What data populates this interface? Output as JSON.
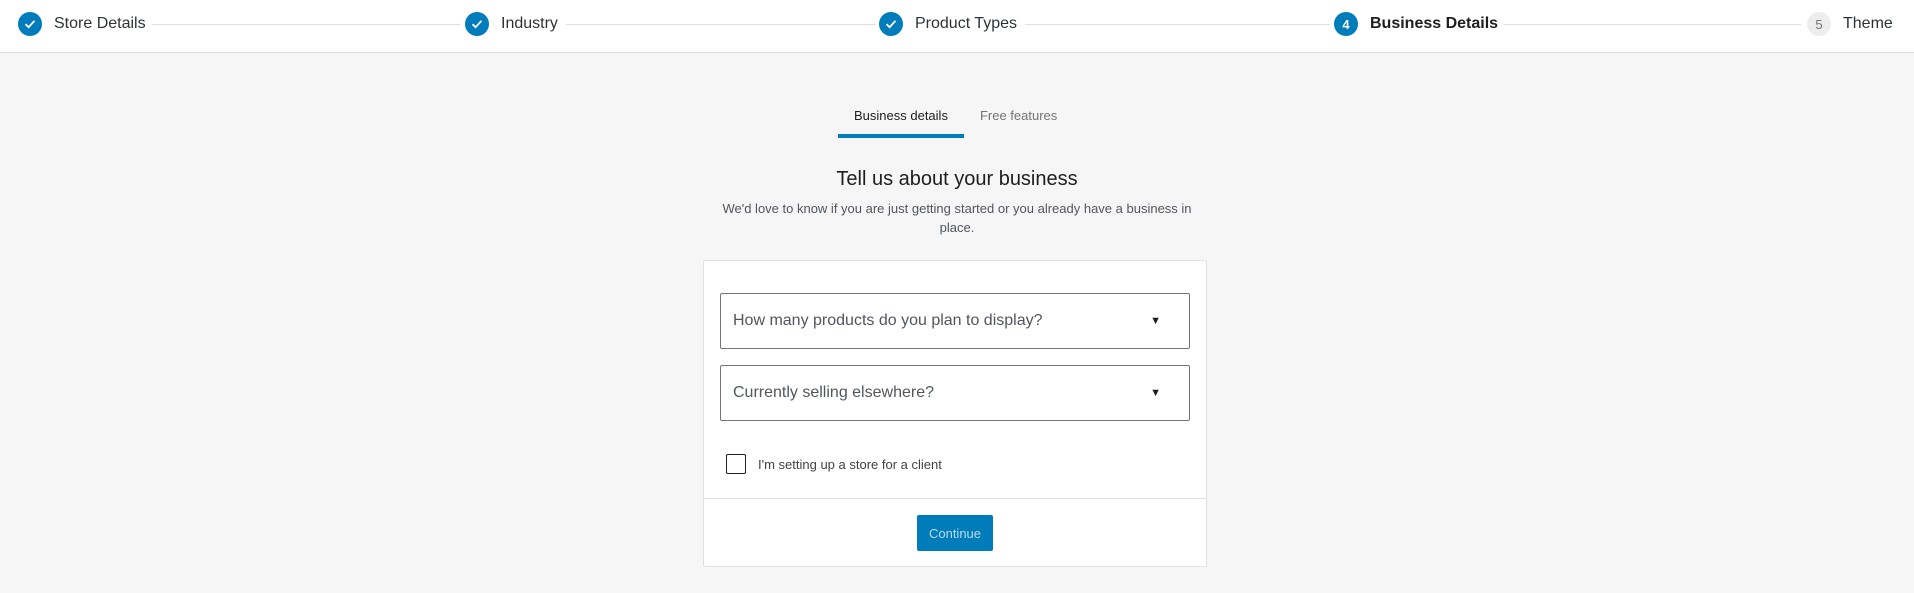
{
  "stepper": {
    "steps": [
      {
        "number": "",
        "label": "Store Details",
        "state": "done"
      },
      {
        "number": "",
        "label": "Industry",
        "state": "done"
      },
      {
        "number": "",
        "label": "Product Types",
        "state": "done"
      },
      {
        "number": "4",
        "label": "Business Details",
        "state": "active"
      },
      {
        "number": "5",
        "label": "Theme",
        "state": "pending"
      }
    ]
  },
  "tabs": [
    {
      "label": "Business details",
      "active": true
    },
    {
      "label": "Free features",
      "active": false
    }
  ],
  "page": {
    "title": "Tell us about your business",
    "subtitle": "We'd love to know if you are just getting started or you already have a business in place."
  },
  "form": {
    "products_select": {
      "placeholder": "How many products do you plan to display?"
    },
    "selling_select": {
      "placeholder": "Currently selling elsewhere?"
    },
    "client_checkbox": {
      "label": "I'm setting up a store for a client",
      "checked": false
    },
    "continue_label": "Continue"
  },
  "colors": {
    "accent": "#007cba",
    "background": "#f6f6f6"
  },
  "icons": {
    "done_step": "check-icon",
    "select_arrow": "caret-down-icon"
  }
}
